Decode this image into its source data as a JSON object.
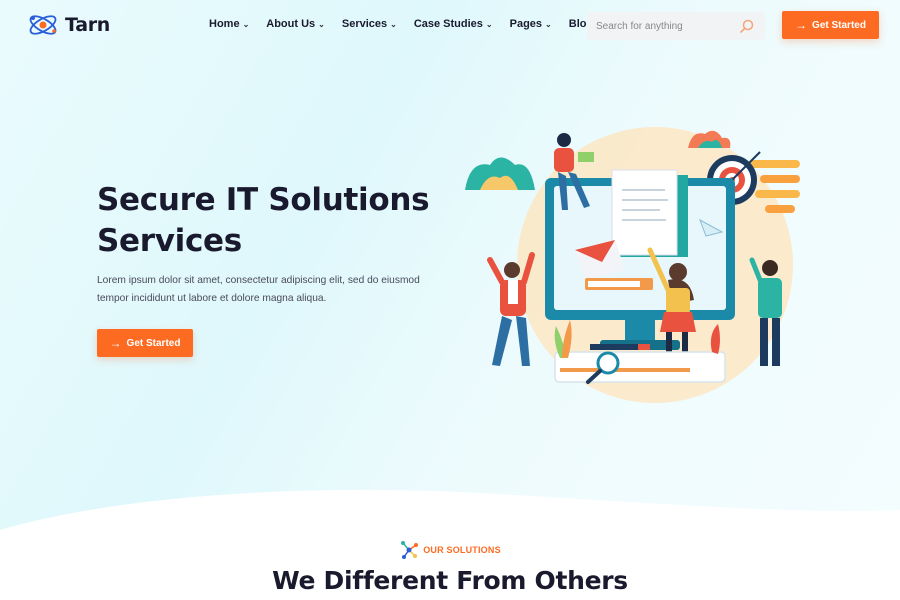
{
  "brand": {
    "name": "Tarn",
    "logo_icon": "atom-icon",
    "accent_color": "#fd6b22",
    "dark_color": "#1a1a2e"
  },
  "nav": {
    "items": [
      {
        "label": "Home",
        "icon": "chevron-down-icon"
      },
      {
        "label": "About Us",
        "icon": "chevron-down-icon"
      },
      {
        "label": "Services",
        "icon": "chevron-down-icon"
      },
      {
        "label": "Case Studies",
        "icon": "chevron-down-icon"
      },
      {
        "label": "Pages",
        "icon": "chevron-down-icon"
      },
      {
        "label": "Blog",
        "icon": "chevron-down-icon"
      }
    ]
  },
  "search": {
    "placeholder": "Search for anything",
    "icon": "search-icon"
  },
  "header_cta": {
    "label": "Get Started",
    "icon": "arrow-right-icon"
  },
  "hero": {
    "title_line1": "Secure IT Solutions",
    "title_line2": "Services",
    "description": "Lorem ipsum dolor sit amet, consectetur adipiscing elit, sed do eiusmod tempor incididunt ut labore et dolore magna aliqua.",
    "cta_label": "Get Started",
    "cta_icon": "arrow-right-icon",
    "illustration": "team-working-on-monitor-illustration"
  },
  "solutions": {
    "tag_icon": "network-nodes-icon",
    "tag": "OUR SOLUTIONS",
    "title": "We Different From Others"
  }
}
